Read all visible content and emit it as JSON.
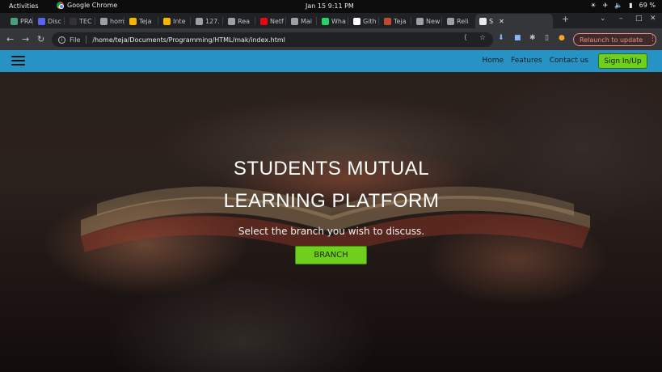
{
  "system_bar": {
    "activities": "Activities",
    "app_name": "Google Chrome",
    "clock": "Jan 15   9:11 PM",
    "battery": "69 %"
  },
  "tabs": [
    {
      "label": "PRA",
      "color": "#4d9f7b"
    },
    {
      "label": "Disc",
      "color": "#5865f2"
    },
    {
      "label": "TEC",
      "color": "#333333"
    },
    {
      "label": "hom",
      "color": "#9aa0a6"
    },
    {
      "label": "Teja",
      "color": "#f7b500"
    },
    {
      "label": "Inte",
      "color": "#f7b500"
    },
    {
      "label": "127.",
      "color": "#9aa0a6"
    },
    {
      "label": "Rea",
      "color": "#9aa0a6"
    },
    {
      "label": "Netf",
      "color": "#e50914"
    },
    {
      "label": "Mai",
      "color": "#9aa0a6"
    },
    {
      "label": "Wha",
      "color": "#25d366"
    },
    {
      "label": "Gith",
      "color": "#ffffff"
    },
    {
      "label": "Teja",
      "color": "#c04a2c"
    },
    {
      "label": "New",
      "color": "#9aa0a6"
    },
    {
      "label": "Reli",
      "color": "#9aa0a6"
    },
    {
      "label": "S",
      "color": "#e8eaed"
    }
  ],
  "browser": {
    "file_label": "File",
    "url": "/home/teja/Documents/Programming/HTML/mak/index.html",
    "relaunch_label": "Relaunch to update"
  },
  "site": {
    "nav": {
      "home": "Home",
      "features": "Features",
      "contact": "Contact us",
      "signin": "Sign In/Up"
    },
    "hero": {
      "title_line1": "STUDENTS MUTUAL",
      "title_line2": "LEARNING PLATFORM",
      "subtitle": "Select the branch you wish to discuss.",
      "button": "BRANCH"
    }
  },
  "colors": {
    "navbar": "#2792c4",
    "accent_green": "#6ed01c"
  }
}
